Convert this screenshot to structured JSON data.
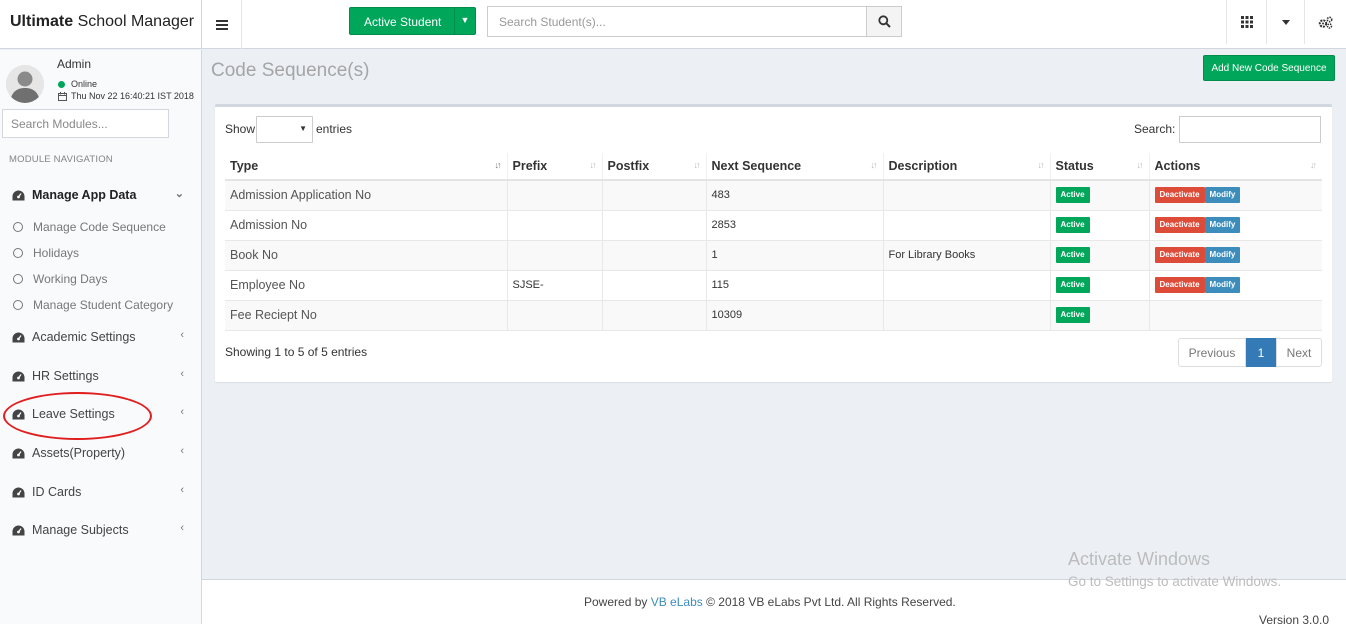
{
  "header": {
    "brand_bold": "Ultimate",
    "brand_rest": "School Manager",
    "active_student_label": "Active Student",
    "search_placeholder": "Search Student(s)..."
  },
  "user": {
    "name": "Admin",
    "status": "Online",
    "datetime": "Thu Nov 22 16:40:21 IST 2018"
  },
  "sidebar": {
    "search_placeholder": "Search Modules...",
    "nav_header": "MODULE NAVIGATION",
    "expanded_menu": "Manage App Data",
    "subitems": [
      "Manage Code Sequence",
      "Holidays",
      "Working Days",
      "Manage Student Category"
    ],
    "menus": [
      "Academic Settings",
      "HR Settings",
      "Leave Settings",
      "Assets(Property)",
      "ID Cards",
      "Manage Subjects"
    ]
  },
  "page": {
    "title": "Code Sequence(s)",
    "add_button": "Add New Code Sequence"
  },
  "table": {
    "show_label": "Show",
    "entries_label": "entries",
    "search_label": "Search:",
    "columns": [
      "Type",
      "Prefix",
      "Postfix",
      "Next Sequence",
      "Description",
      "Status",
      "Actions"
    ],
    "rows": [
      {
        "type": "Admission Application No",
        "prefix": "",
        "postfix": "",
        "next": "483",
        "description": "",
        "status": "Active",
        "actions": [
          "Deactivate",
          "Modify"
        ]
      },
      {
        "type": "Admission No",
        "prefix": "",
        "postfix": "",
        "next": "2853",
        "description": "",
        "status": "Active",
        "actions": [
          "Deactivate",
          "Modify"
        ]
      },
      {
        "type": "Book No",
        "prefix": "",
        "postfix": "",
        "next": "1",
        "description": "For Library Books",
        "status": "Active",
        "actions": [
          "Deactivate",
          "Modify"
        ]
      },
      {
        "type": "Employee No",
        "prefix": "SJSE-",
        "postfix": "",
        "next": "115",
        "description": "",
        "status": "Active",
        "actions": [
          "Deactivate",
          "Modify"
        ]
      },
      {
        "type": "Fee Reciept No",
        "prefix": "",
        "postfix": "",
        "next": "10309",
        "description": "",
        "status": "Active",
        "actions": []
      }
    ],
    "info": "Showing 1 to 5 of 5 entries",
    "pagination": {
      "previous": "Previous",
      "current": "1",
      "next": "Next"
    }
  },
  "footer": {
    "powered_by": "Powered by",
    "link": "VB eLabs",
    "copyright": "© 2018 VB eLabs Pvt Ltd. All Rights Reserved.",
    "version": "Version 3.0.0"
  },
  "watermark": {
    "line1": "Activate Windows",
    "line2": "Go to Settings to activate Windows."
  },
  "colors": {
    "success": "#00a65a",
    "danger": "#dd4b39",
    "primary": "#3c8dbc",
    "annotation": "#e01e1e"
  }
}
